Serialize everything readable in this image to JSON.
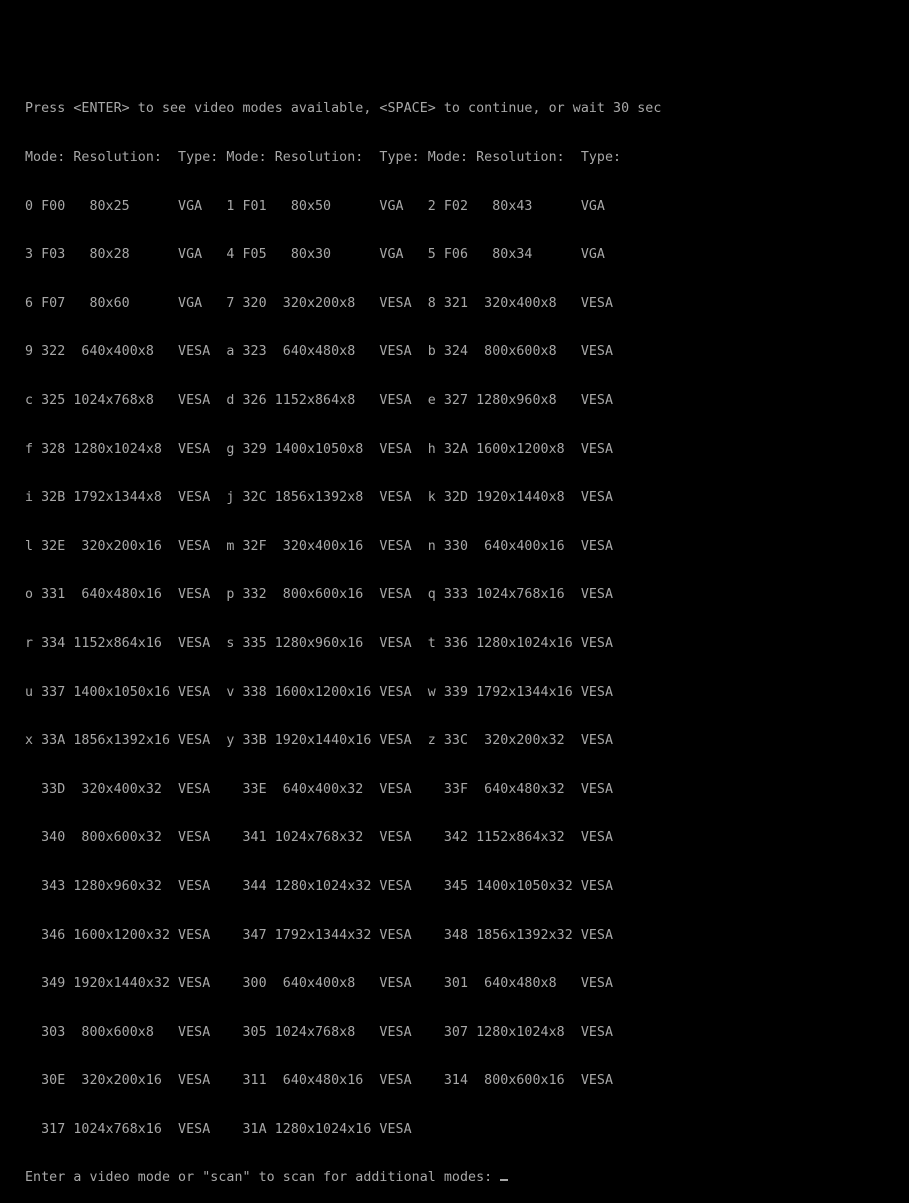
{
  "screen": {
    "prompt": "Press <ENTER> to see video modes available, <SPACE> to continue, or wait 30 sec",
    "header": "Mode: Resolution:  Type: Mode: Resolution:  Type: Mode: Resolution:  Type:",
    "rows": [
      "0 F00   80x25      VGA   1 F01   80x50      VGA   2 F02   80x43      VGA",
      "3 F03   80x28      VGA   4 F05   80x30      VGA   5 F06   80x34      VGA",
      "6 F07   80x60      VGA   7 320  320x200x8   VESA  8 321  320x400x8   VESA",
      "9 322  640x400x8   VESA  a 323  640x480x8   VESA  b 324  800x600x8   VESA",
      "c 325 1024x768x8   VESA  d 326 1152x864x8   VESA  e 327 1280x960x8   VESA",
      "f 328 1280x1024x8  VESA  g 329 1400x1050x8  VESA  h 32A 1600x1200x8  VESA",
      "i 32B 1792x1344x8  VESA  j 32C 1856x1392x8  VESA  k 32D 1920x1440x8  VESA",
      "l 32E  320x200x16  VESA  m 32F  320x400x16  VESA  n 330  640x400x16  VESA",
      "o 331  640x480x16  VESA  p 332  800x600x16  VESA  q 333 1024x768x16  VESA",
      "r 334 1152x864x16  VESA  s 335 1280x960x16  VESA  t 336 1280x1024x16 VESA",
      "u 337 1400x1050x16 VESA  v 338 1600x1200x16 VESA  w 339 1792x1344x16 VESA",
      "x 33A 1856x1392x16 VESA  y 33B 1920x1440x16 VESA  z 33C  320x200x32  VESA",
      "  33D  320x400x32  VESA    33E  640x400x32  VESA    33F  640x480x32  VESA",
      "  340  800x600x32  VESA    341 1024x768x32  VESA    342 1152x864x32  VESA",
      "  343 1280x960x32  VESA    344 1280x1024x32 VESA    345 1400x1050x32 VESA",
      "  346 1600x1200x32 VESA    347 1792x1344x32 VESA    348 1856x1392x32 VESA",
      "  349 1920x1440x32 VESA    300  640x400x8   VESA    301  640x480x8   VESA",
      "  303  800x600x8   VESA    305 1024x768x8   VESA    307 1280x1024x8  VESA",
      "  30E  320x200x16  VESA    311  640x480x16  VESA    314  800x600x16  VESA",
      "  317 1024x768x16  VESA    31A 1280x1024x16 VESA"
    ],
    "input_prompt": "Enter a video mode or \"scan\" to scan for additional modes: ",
    "input_value": ""
  },
  "colors": {
    "background": "#000000",
    "text": "#a8a8a8"
  }
}
